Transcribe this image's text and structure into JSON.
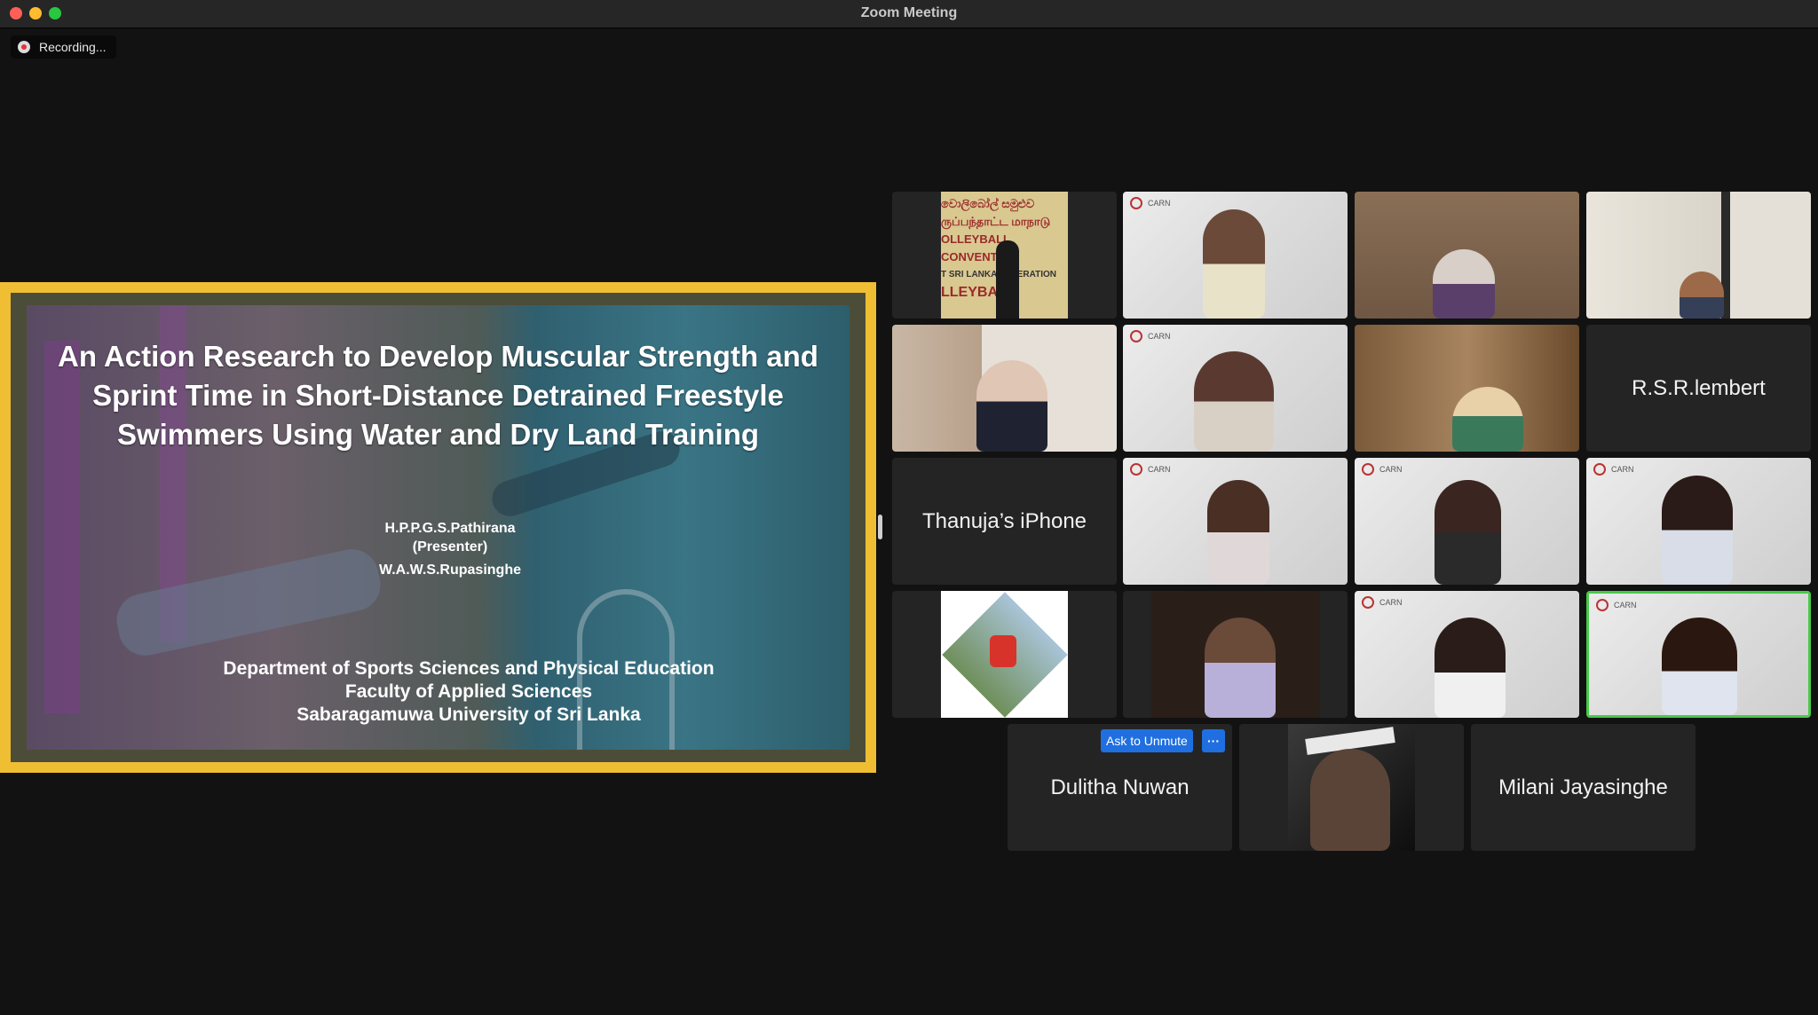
{
  "window": {
    "title": "Zoom Meeting"
  },
  "recording": {
    "label": "Recording..."
  },
  "slide": {
    "title_lines": [
      "An Action Research to Develop Muscular Strength and",
      "Sprint Time in Short-Distance Detrained Freestyle",
      "Swimmers Using Water and Dry Land Training"
    ],
    "presenter": "H.P.P.G.S.Pathirana",
    "presenter_role": "(Presenter)",
    "coauthor": "W.A.W.S.Rupasinghe",
    "affiliation": [
      "Department of Sports Sciences and Physical Education",
      "Faculty of Applied Sciences",
      "Sabaragamuwa University of Sri Lanka"
    ],
    "banner_text": [
      "වොලිබෝල් සමුළුව",
      "ருப்பந்தாட்ட மாநாடு",
      "OLLEYBALL CONVENTION",
      "T SRI LANKA FEDERATION",
      "LLEYBALL"
    ]
  },
  "carn_logo_text": "CARN",
  "participants": {
    "name_tiles": {
      "rsr": "R.S.R.lembert",
      "thanuja": "Thanuja’s iPhone",
      "dulitha": "Dulitha Nuwan",
      "milani": "Milani Jayasinghe"
    },
    "ask_to_unmute": "Ask to Unmute",
    "more": "···"
  },
  "colors": {
    "share_border": "#f0be32",
    "active_speaker": "#49c949",
    "unmute_button": "#1f6fe0"
  }
}
